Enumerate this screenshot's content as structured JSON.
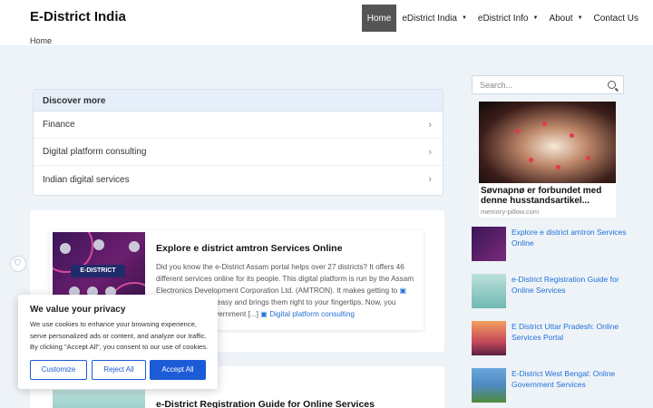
{
  "site": {
    "title": "E-District India"
  },
  "nav": {
    "items": [
      {
        "label": "Home",
        "active": true,
        "caret": false
      },
      {
        "label": "eDistrict India",
        "active": false,
        "caret": true
      },
      {
        "label": "eDistrict Info",
        "active": false,
        "caret": true
      },
      {
        "label": "About",
        "active": false,
        "caret": true
      },
      {
        "label": "Contact Us",
        "active": false,
        "caret": false
      }
    ]
  },
  "breadcrumb": "Home",
  "discover": {
    "heading": "Discover more",
    "items": [
      "Finance",
      "Digital platform consulting",
      "Indian digital services"
    ]
  },
  "post1": {
    "thumb_label": "E-DISTRICT",
    "title": "Explore e district amtron Services Online",
    "excerpt": "Did you know the e-District Assam portal helps over 27 districts? It offers 46 different services online for its people. This digital platform is run by the Assam Electronics Development Corporation Ltd. (AMTRON). It makes getting to",
    "excerpt2": "es easy and brings them right to your fingertips. Now, you",
    "excerpt3": "government [...]",
    "tag": "Digital platform consulting"
  },
  "post2": {
    "title": "e-District Registration Guide for Online Services"
  },
  "search": {
    "placeholder": "Search..."
  },
  "ad": {
    "headline": "Søvnapnø er forbundet med denne husstandsartikel...",
    "source": "memory-pillow.com"
  },
  "sidebar_posts": [
    {
      "title": "Explore e district amtron Services Online",
      "thumb_color": "#4a1f66"
    },
    {
      "title": "e-District Registration Guide for Online Services",
      "thumb_color": "#6fb9b0"
    },
    {
      "title": "E District Uttar Pradesh: Online Services Portal",
      "thumb_color": "#c64a5a"
    },
    {
      "title": "E-District West Bengal: Online Government Services",
      "thumb_color": "#4f8bc2"
    }
  ],
  "cookie": {
    "title": "We value your privacy",
    "text": "We use cookies to enhance your browsing experience, serve personalized ads or content, and analyze our traffic. By clicking \"Accept All\", you consent to our use of cookies.",
    "customize": "Customize",
    "reject": "Reject All",
    "accept": "Accept All"
  },
  "colors": {
    "accent": "#1c5bd6",
    "link": "#1f6fd6",
    "nav_active": "#555555"
  }
}
